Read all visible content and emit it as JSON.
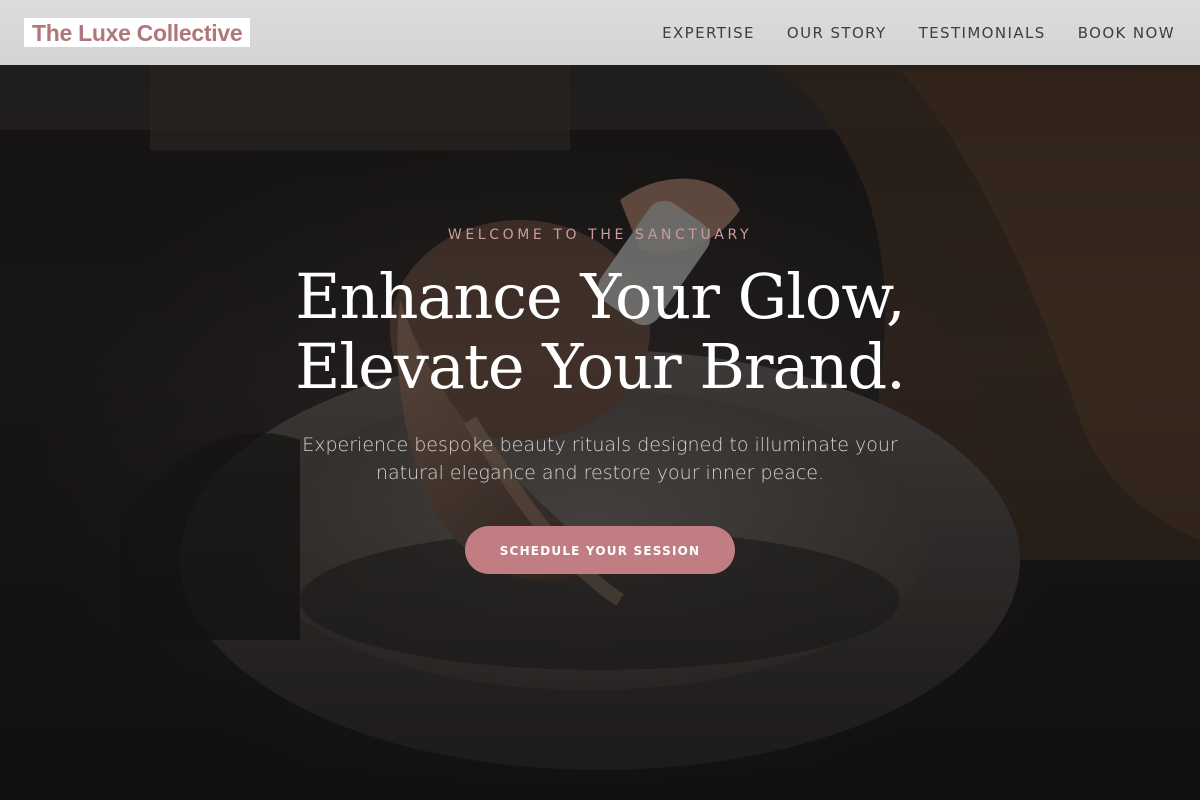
{
  "header": {
    "logo_text": "The Luxe Collective",
    "nav": [
      {
        "label": "EXPERTISE"
      },
      {
        "label": "OUR STORY"
      },
      {
        "label": "TESTIMONIALS"
      },
      {
        "label": "BOOK NOW"
      }
    ]
  },
  "hero": {
    "eyebrow": "WELCOME TO THE SANCTUARY",
    "headline_line1": "Enhance Your Glow,",
    "headline_line2": "Elevate Your Brand.",
    "subtitle": "Experience bespoke beauty rituals designed to illuminate your natural elegance and restore your inner peace.",
    "cta_label": "SCHEDULE YOUR SESSION"
  },
  "colors": {
    "accent": "#c07e82",
    "logo_text": "#b0767a",
    "eyebrow": "#c99c9e",
    "header_bg": "#d8d8d8",
    "hero_bg": "#1f1c1b"
  }
}
